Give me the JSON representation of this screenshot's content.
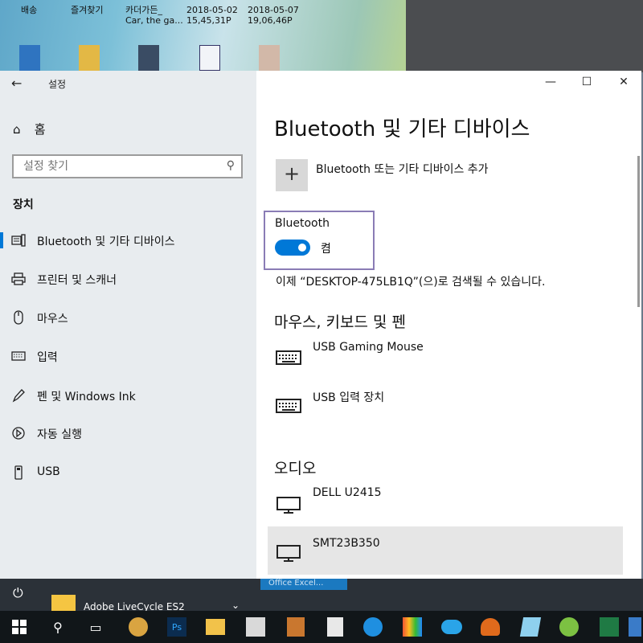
{
  "desktop": {
    "labels": [
      "배송",
      "즐겨찾기",
      "카더가든_\nCar, the ga...",
      "2018-05-02\n15,45,31P",
      "2018-05-07\n19,06,46P"
    ]
  },
  "window": {
    "title": "설정",
    "controls": {
      "minimize": "—",
      "maximize": "☐",
      "close": "✕"
    }
  },
  "sidebar": {
    "home_label": "홈",
    "search_placeholder": "설정 찾기",
    "section": "장치",
    "items": [
      {
        "label": "Bluetooth 및 기타 디바이스",
        "icon": "bluetooth-devices-icon",
        "active": true
      },
      {
        "label": "프린터 및 스캐너",
        "icon": "printer-icon"
      },
      {
        "label": "마우스",
        "icon": "mouse-icon"
      },
      {
        "label": "입력",
        "icon": "keyboard-icon"
      },
      {
        "label": "펜 및 Windows Ink",
        "icon": "pen-icon"
      },
      {
        "label": "자동 실행",
        "icon": "autoplay-icon"
      },
      {
        "label": "USB",
        "icon": "usb-icon"
      }
    ]
  },
  "main": {
    "title": "Bluetooth 및 기타 디바이스",
    "add_device_label": "Bluetooth 또는 기타 디바이스 추가",
    "bluetooth": {
      "label": "Bluetooth",
      "state": "켬",
      "on": true
    },
    "discoverable_text": "이제 “DESKTOP-475LB1Q”(으)로 검색될 수 있습니다.",
    "groups": [
      {
        "title": "마우스, 키보드 및 펜",
        "devices": [
          {
            "name": "USB Gaming Mouse",
            "icon": "keyboard-icon"
          },
          {
            "name": "USB 입력 장치",
            "icon": "keyboard-icon"
          }
        ]
      },
      {
        "title": "오디오",
        "devices": [
          {
            "name": "DELL U2415",
            "icon": "monitor-icon"
          },
          {
            "name": "SMT23B350",
            "icon": "monitor-icon",
            "selected": true
          }
        ]
      }
    ]
  },
  "start_menu": {
    "app_label": "Adobe LiveCycle ES2",
    "hint": "Office Excel..."
  },
  "taskbar": {
    "icons": [
      "start-icon",
      "search-icon",
      "task-view-icon",
      "app-owl-icon",
      "photoshop-icon",
      "file-explorer-icon",
      "app-pe-icon",
      "app-s-icon",
      "calculator-icon",
      "edge-icon",
      "app-chart-icon",
      "cloud-icon",
      "app-mushroom-icon",
      "app-blue-icon",
      "app-green-icon",
      "excel-icon",
      "app-edge-icon"
    ],
    "ps_label": "Ps"
  },
  "colors": {
    "accent": "#0078d7",
    "highlight_box": "#8a7cb5",
    "sidebar_bg": "#e8ecef"
  }
}
